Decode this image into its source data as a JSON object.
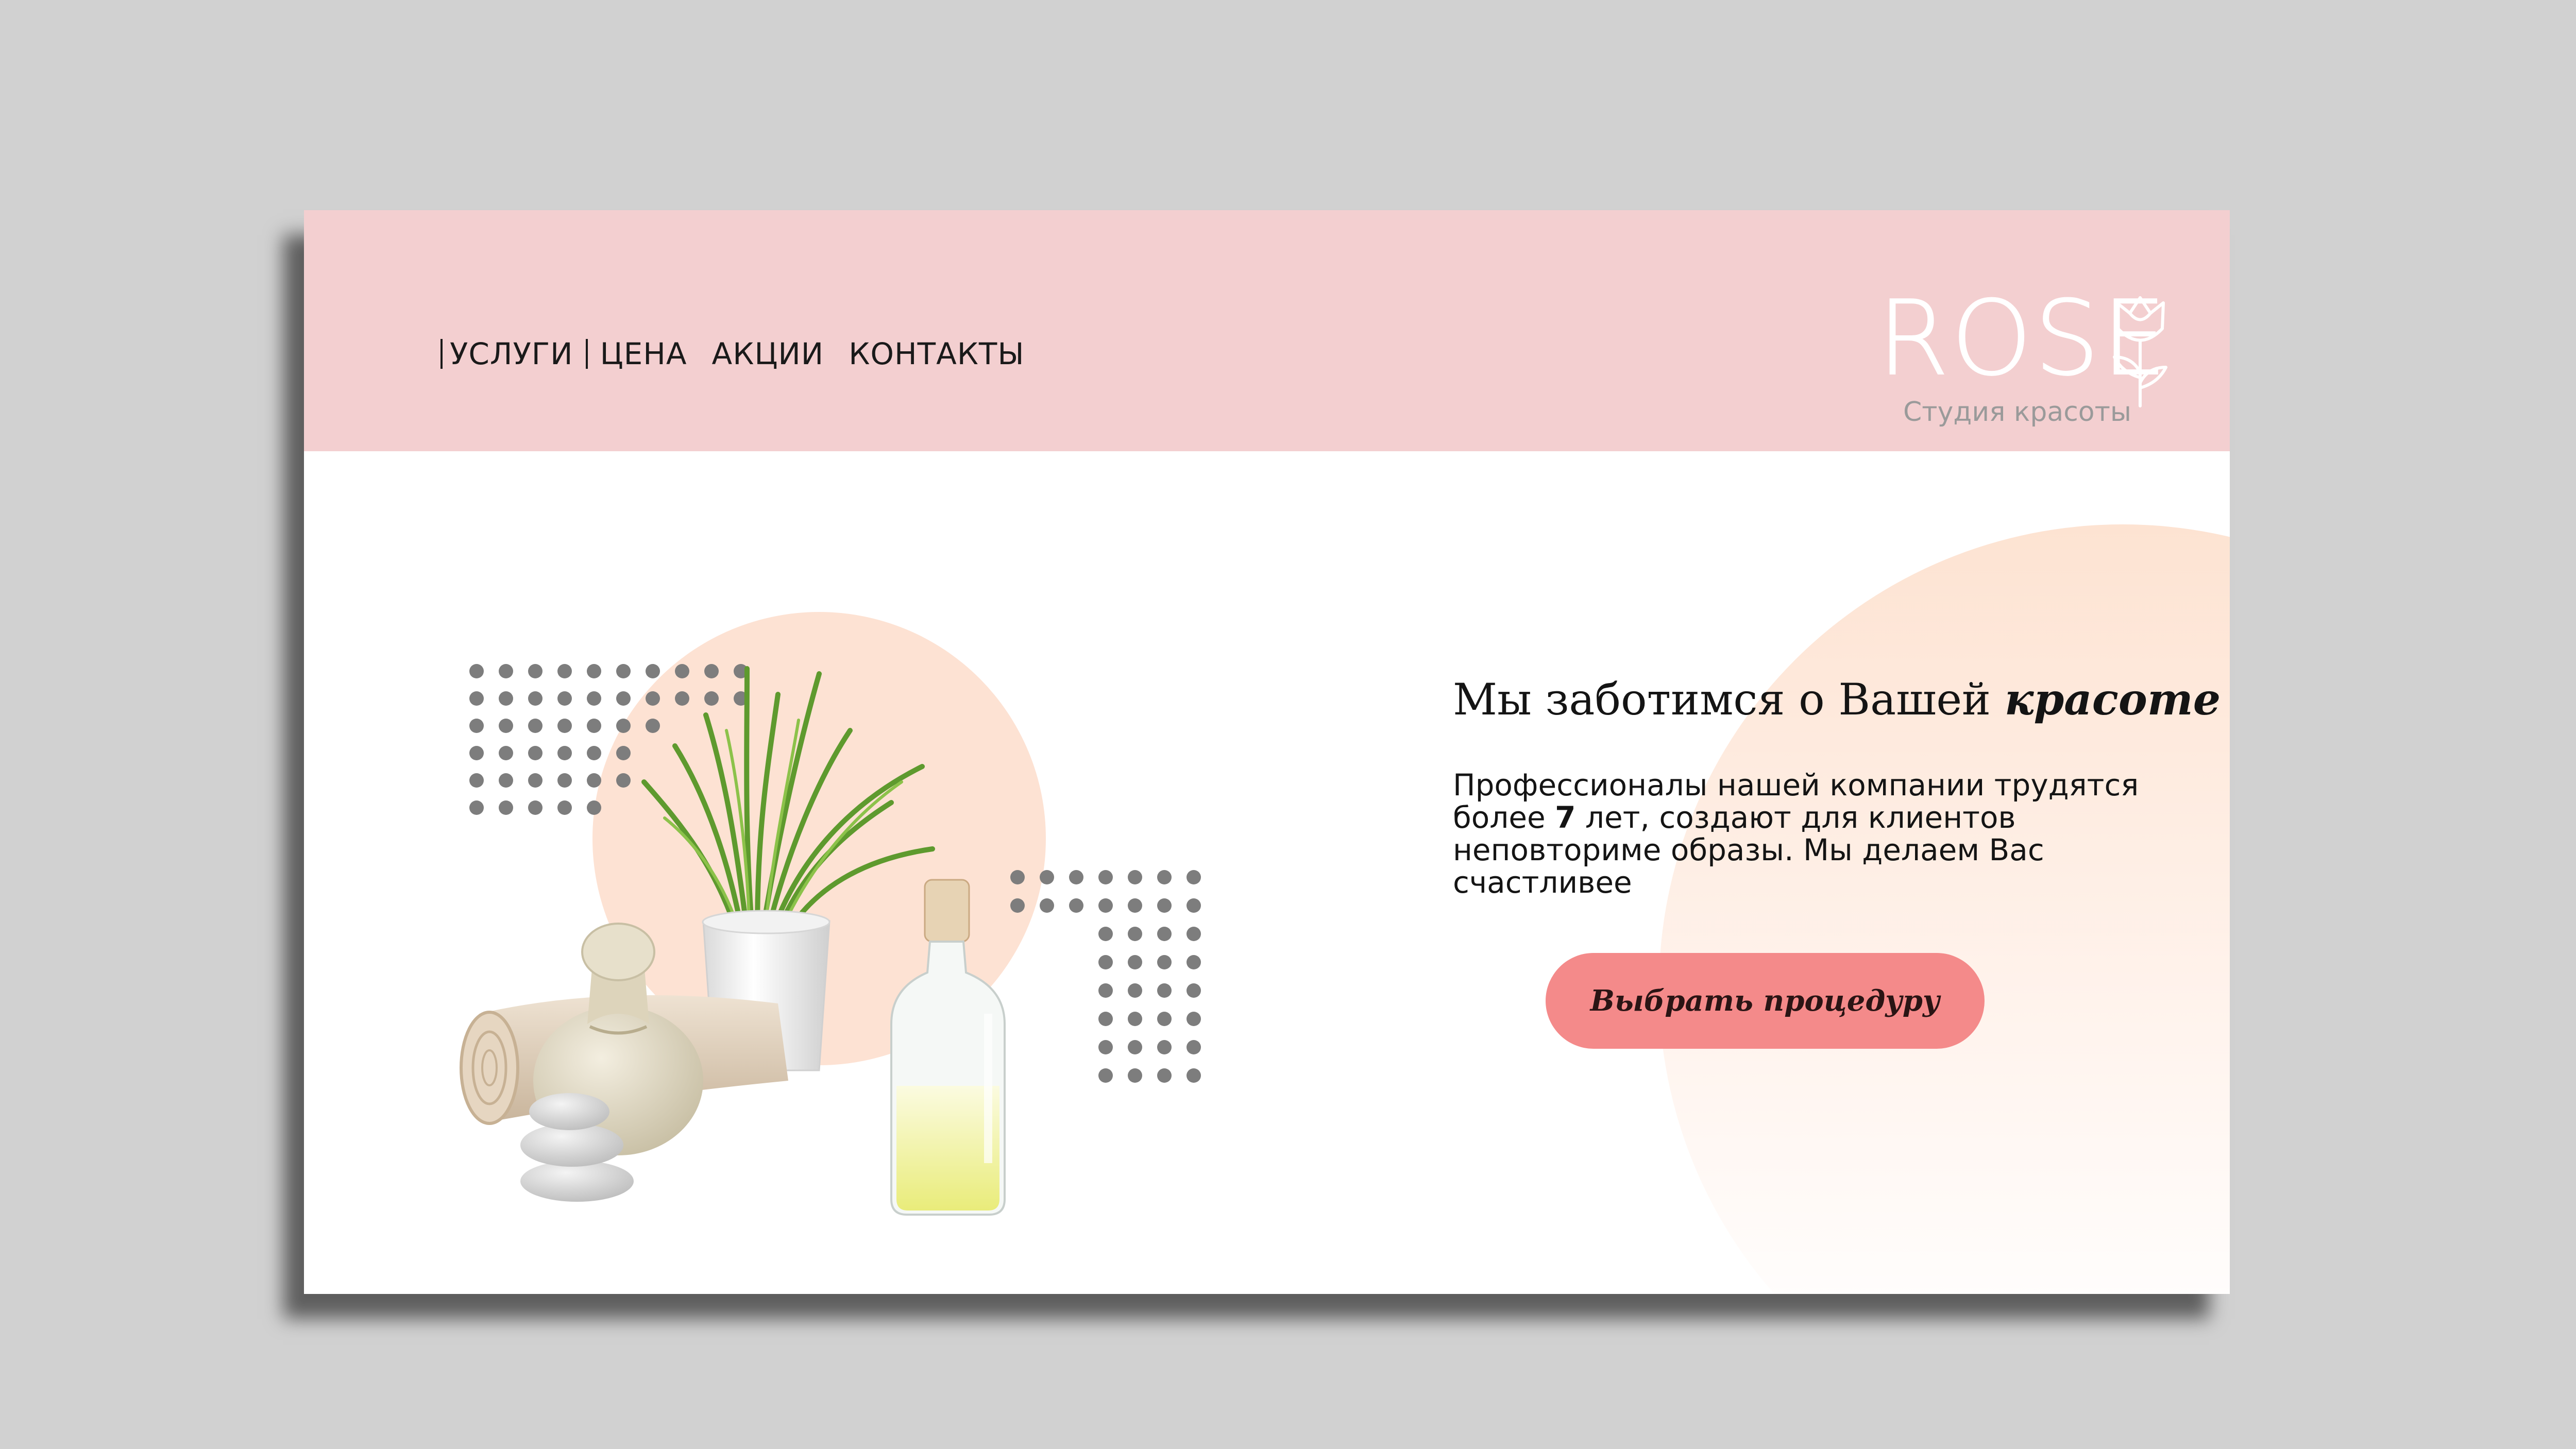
{
  "nav": {
    "items": [
      {
        "label": "УСЛУГИ"
      },
      {
        "label": "ЦЕНА"
      },
      {
        "label": "АКЦИИ"
      },
      {
        "label": "КОНТАКТЫ"
      }
    ]
  },
  "logo": {
    "name": "ROSE",
    "subtitle": "Студия красоты",
    "icon": "rose-flower-icon"
  },
  "hero": {
    "title_plain": "Мы заботимся о Вашей ",
    "title_accent": "красоте",
    "text_1": "Профессионалы нашей компании трудятся более ",
    "text_years": "7",
    "text_2": " лет, создают для клиентов неповториме образы. Мы делаем Вас счастливее",
    "button_label": "Выбрать процедуру"
  },
  "colors": {
    "header_bg": "#f3cfd0",
    "accent_button": "#f48a8a",
    "blob_peach": "#fde2d3",
    "dots_gray": "#7d7d7d",
    "logo_sub": "#9a9a9a"
  }
}
